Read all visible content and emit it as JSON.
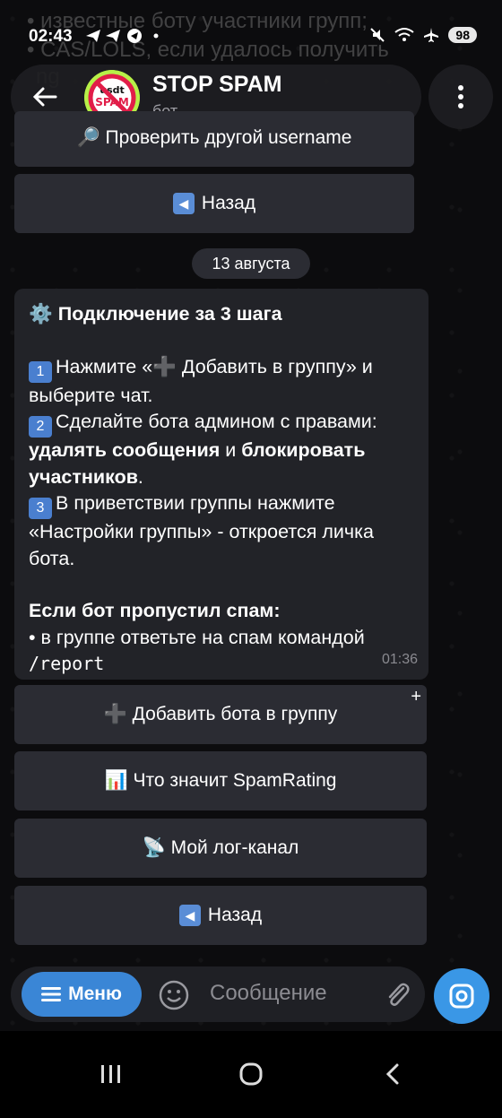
{
  "status_bar": {
    "time": "02:43",
    "battery": "98",
    "ghost_line_1": "• известные боту участники групп;",
    "ghost_line_2": "• CAS/LOLS, если удалось получить",
    "ghost_line_3": "ng"
  },
  "header": {
    "title": "STOP SPAM",
    "subtitle": "бот",
    "avatar_text_1": "usdt",
    "avatar_text_2": "SPAM"
  },
  "top_buttons": {
    "check_username": "🔎 Проверить другой username",
    "back": "Назад"
  },
  "date_pill": "13 августа",
  "message": {
    "title": "⚙️ Подключение за 3 шага",
    "step1_num": "1",
    "step1": "Нажмите «➕ Добавить в группу» и выберите чат.",
    "step2_num": "2",
    "step2_pre": "Сделайте бота админом с правами: ",
    "step2_bold1": "удалять сообщения",
    "step2_mid": " и ",
    "step2_bold2": "блокировать участников",
    "step2_end": ".",
    "step3_num": "3",
    "step3": "В приветствии группы нажмите «Настройки группы» - откроется личка бота.",
    "spam_title": "Если бот пропустил спам:",
    "spam_line": "• в группе ответьте на спам командой ",
    "spam_cmd": "/report",
    "time": "01:36"
  },
  "bottom_buttons": {
    "add_bot": "➕ Добавить бота в группу",
    "spamrating": "📊 Что значит SpamRating",
    "log_channel": "📡 Мой лог-канал",
    "back": "Назад",
    "corner_plus": "+"
  },
  "input_bar": {
    "menu_label": "Меню",
    "placeholder": "Сообщение"
  }
}
